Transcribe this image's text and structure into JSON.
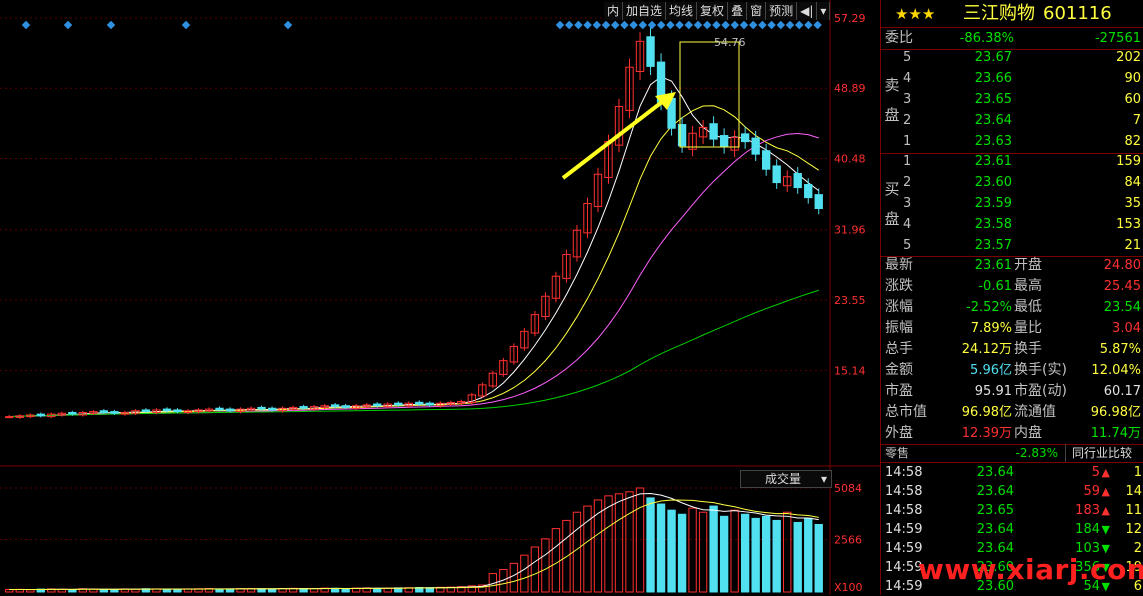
{
  "toolbar": {
    "items": [
      "内",
      "加自选",
      "均线",
      "复权",
      "叠",
      "窗",
      "预测"
    ]
  },
  "chart_data": {
    "type": "candlestick",
    "price_ticks": [
      "57.29",
      "48.89",
      "40.48",
      "31.96",
      "23.55",
      "15.14"
    ],
    "volume_ticks": [
      "5084",
      "2566",
      "X100"
    ],
    "volume_dropdown": "成交量",
    "peak_label": "54.76",
    "ylim": [
      8.0,
      57.29
    ],
    "closes": [
      9.6,
      9.7,
      9.8,
      9.7,
      9.9,
      10.0,
      9.9,
      10.1,
      10.2,
      10.1,
      10.0,
      10.1,
      10.3,
      10.2,
      10.4,
      10.3,
      10.2,
      10.3,
      10.4,
      10.5,
      10.4,
      10.3,
      10.5,
      10.6,
      10.5,
      10.4,
      10.6,
      10.7,
      10.6,
      10.8,
      10.9,
      10.8,
      10.7,
      10.9,
      11.0,
      10.9,
      11.1,
      11.0,
      11.2,
      11.1,
      11.0,
      11.2,
      11.3,
      11.4,
      12.2,
      13.4,
      14.8,
      16.3,
      18.0,
      19.8,
      21.8,
      24.0,
      26.4,
      29.0,
      31.9,
      35.1,
      38.6,
      42.5,
      46.7,
      51.4,
      54.5,
      51.5,
      47.2,
      44.1,
      42.0,
      43.5,
      44.2,
      42.8,
      41.9,
      43.0,
      42.5,
      41.0,
      39.2,
      37.6,
      38.3,
      37.0,
      35.8,
      34.5
    ],
    "volumes": [
      120,
      130,
      110,
      140,
      150,
      130,
      120,
      160,
      140,
      130,
      120,
      150,
      140,
      160,
      150,
      130,
      140,
      150,
      160,
      170,
      140,
      150,
      160,
      170,
      160,
      150,
      170,
      180,
      160,
      170,
      190,
      180,
      170,
      190,
      200,
      180,
      190,
      200,
      210,
      220,
      210,
      230,
      240,
      260,
      300,
      340,
      900,
      1100,
      1400,
      1800,
      2200,
      2600,
      3100,
      3500,
      3900,
      4200,
      4500,
      4700,
      4800,
      4900,
      5084,
      4600,
      4300,
      4000,
      3800,
      4100,
      3900,
      4200,
      3700,
      4000,
      3800,
      3600,
      3700,
      3500,
      3900,
      3400,
      3600,
      3300
    ],
    "ma_colors": {
      "ma5": "#ffffff",
      "ma10": "#ffff40",
      "ma20": "#ff60ff",
      "ma60": "#00d000"
    }
  },
  "stock": {
    "rating": "★★★",
    "name": "三江购物",
    "code": "601116"
  },
  "weibi": {
    "label": "委比",
    "pct": "-86.38%",
    "diff": "-27561"
  },
  "sell": {
    "label_top": "卖",
    "label_bottom": "盘",
    "rows": [
      {
        "lvl": "5",
        "price": "23.67",
        "vol": "202"
      },
      {
        "lvl": "4",
        "price": "23.66",
        "vol": "90"
      },
      {
        "lvl": "3",
        "price": "23.65",
        "vol": "60"
      },
      {
        "lvl": "2",
        "price": "23.64",
        "vol": "7"
      },
      {
        "lvl": "1",
        "price": "23.63",
        "vol": "82"
      }
    ]
  },
  "buy": {
    "label_top": "买",
    "label_bottom": "盘",
    "rows": [
      {
        "lvl": "1",
        "price": "23.61",
        "vol": "159"
      },
      {
        "lvl": "2",
        "price": "23.60",
        "vol": "84"
      },
      {
        "lvl": "3",
        "price": "23.59",
        "vol": "35"
      },
      {
        "lvl": "4",
        "price": "23.58",
        "vol": "153"
      },
      {
        "lvl": "5",
        "price": "23.57",
        "vol": "21"
      }
    ]
  },
  "stats": [
    {
      "l1": "最新",
      "v1": "23.61",
      "c1": "green",
      "l2": "开盘",
      "v2": "24.80",
      "c2": "red"
    },
    {
      "l1": "涨跌",
      "v1": "-0.61",
      "c1": "green",
      "l2": "最高",
      "v2": "25.45",
      "c2": "red"
    },
    {
      "l1": "涨幅",
      "v1": "-2.52%",
      "c1": "green",
      "l2": "最低",
      "v2": "23.54",
      "c2": "green"
    },
    {
      "l1": "振幅",
      "v1": "7.89%",
      "c1": "yellow",
      "l2": "量比",
      "v2": "3.04",
      "c2": "red"
    },
    {
      "l1": "总手",
      "v1": "24.12万",
      "c1": "yellow",
      "l2": "换手",
      "v2": "5.87%",
      "c2": "yellow"
    },
    {
      "l1": "金额",
      "v1": "5.96亿",
      "c1": "cyan",
      "l2": "换手(实)",
      "v2": "12.04%",
      "c2": "yellow"
    },
    {
      "l1": "市盈",
      "v1": "95.91",
      "c1": "white",
      "l2": "市盈(动)",
      "v2": "60.17",
      "c2": "white"
    },
    {
      "l1": "总市值",
      "v1": "96.98亿",
      "c1": "yellow",
      "l2": "流通值",
      "v2": "96.98亿",
      "c2": "yellow"
    },
    {
      "l1": "外盘",
      "v1": "12.39万",
      "c1": "red",
      "l2": "内盘",
      "v2": "11.74万",
      "c2": "green"
    }
  ],
  "sector": {
    "label": "零售",
    "pct": "-2.83%",
    "compare": "同行业比较"
  },
  "ticks": [
    {
      "time": "14:58",
      "price": "23.64",
      "vol": "5",
      "dir": "up",
      "n": "1"
    },
    {
      "time": "14:58",
      "price": "23.64",
      "vol": "59",
      "dir": "up",
      "n": "14"
    },
    {
      "time": "14:58",
      "price": "23.65",
      "vol": "183",
      "dir": "up",
      "n": "11"
    },
    {
      "time": "14:59",
      "price": "23.64",
      "vol": "184",
      "dir": "down",
      "n": "12"
    },
    {
      "time": "14:59",
      "price": "23.64",
      "vol": "103",
      "dir": "down",
      "n": "2"
    },
    {
      "time": "14:59",
      "price": "23.60",
      "vol": "356",
      "dir": "down",
      "n": "19"
    },
    {
      "time": "14:59",
      "price": "23.60",
      "vol": "54",
      "dir": "down",
      "n": "6"
    }
  ],
  "watermark": "www.xiarj.com"
}
